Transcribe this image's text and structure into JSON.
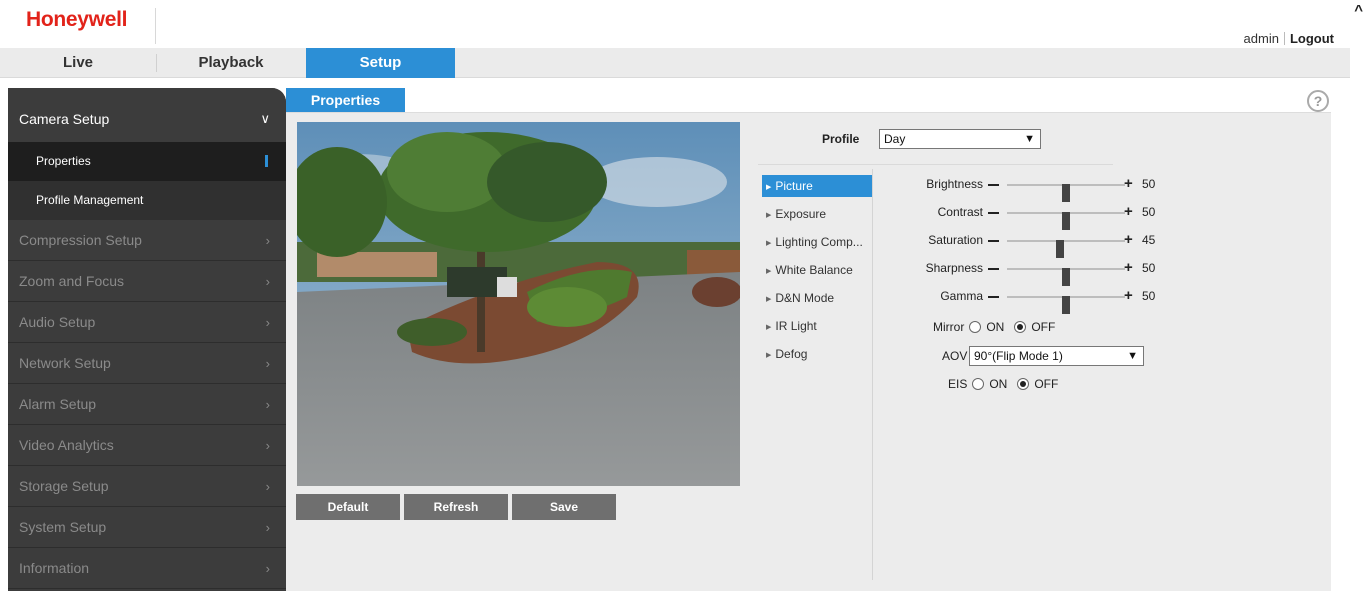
{
  "header": {
    "brand": "Honeywell",
    "user": "admin",
    "logout": "Logout"
  },
  "nav": {
    "tabs": [
      "Live",
      "Playback",
      "Setup"
    ],
    "active": "Setup"
  },
  "sidebar": {
    "section": "Camera Setup",
    "subitems": [
      "Properties",
      "Profile Management"
    ],
    "active_subitem": "Properties",
    "items": [
      "Compression Setup",
      "Zoom and Focus",
      "Audio Setup",
      "Network Setup",
      "Alarm Setup",
      "Video Analytics",
      "Storage Setup",
      "System Setup",
      "Information"
    ]
  },
  "content": {
    "tab_title": "Properties",
    "buttons": {
      "default": "Default",
      "refresh": "Refresh",
      "save": "Save"
    },
    "profile": {
      "label": "Profile",
      "value": "Day"
    },
    "subtabs": [
      "Picture",
      "Exposure",
      "Lighting Comp...",
      "White Balance",
      "D&N Mode",
      "IR Light",
      "Defog"
    ],
    "active_subtab": "Picture",
    "sliders": [
      {
        "label": "Brightness",
        "value": 50
      },
      {
        "label": "Contrast",
        "value": 50
      },
      {
        "label": "Saturation",
        "value": 45
      },
      {
        "label": "Sharpness",
        "value": 50
      },
      {
        "label": "Gamma",
        "value": 50
      }
    ],
    "mirror": {
      "label": "Mirror",
      "on": "ON",
      "off": "OFF",
      "selected": "OFF"
    },
    "aov": {
      "label": "AOV",
      "value": "90°(Flip Mode 1)"
    },
    "eis": {
      "label": "EIS",
      "on": "ON",
      "off": "OFF",
      "selected": "OFF"
    }
  },
  "colors": {
    "brand_red": "#e2231a",
    "accent_blue": "#2c8fd6",
    "sidebar_bg": "#3c3c3c"
  },
  "icons": {
    "help": "help-circle-icon",
    "chevron": "chevron-right-icon",
    "expand": "chevron-down-icon",
    "subtab": "triangle-right-icon"
  }
}
